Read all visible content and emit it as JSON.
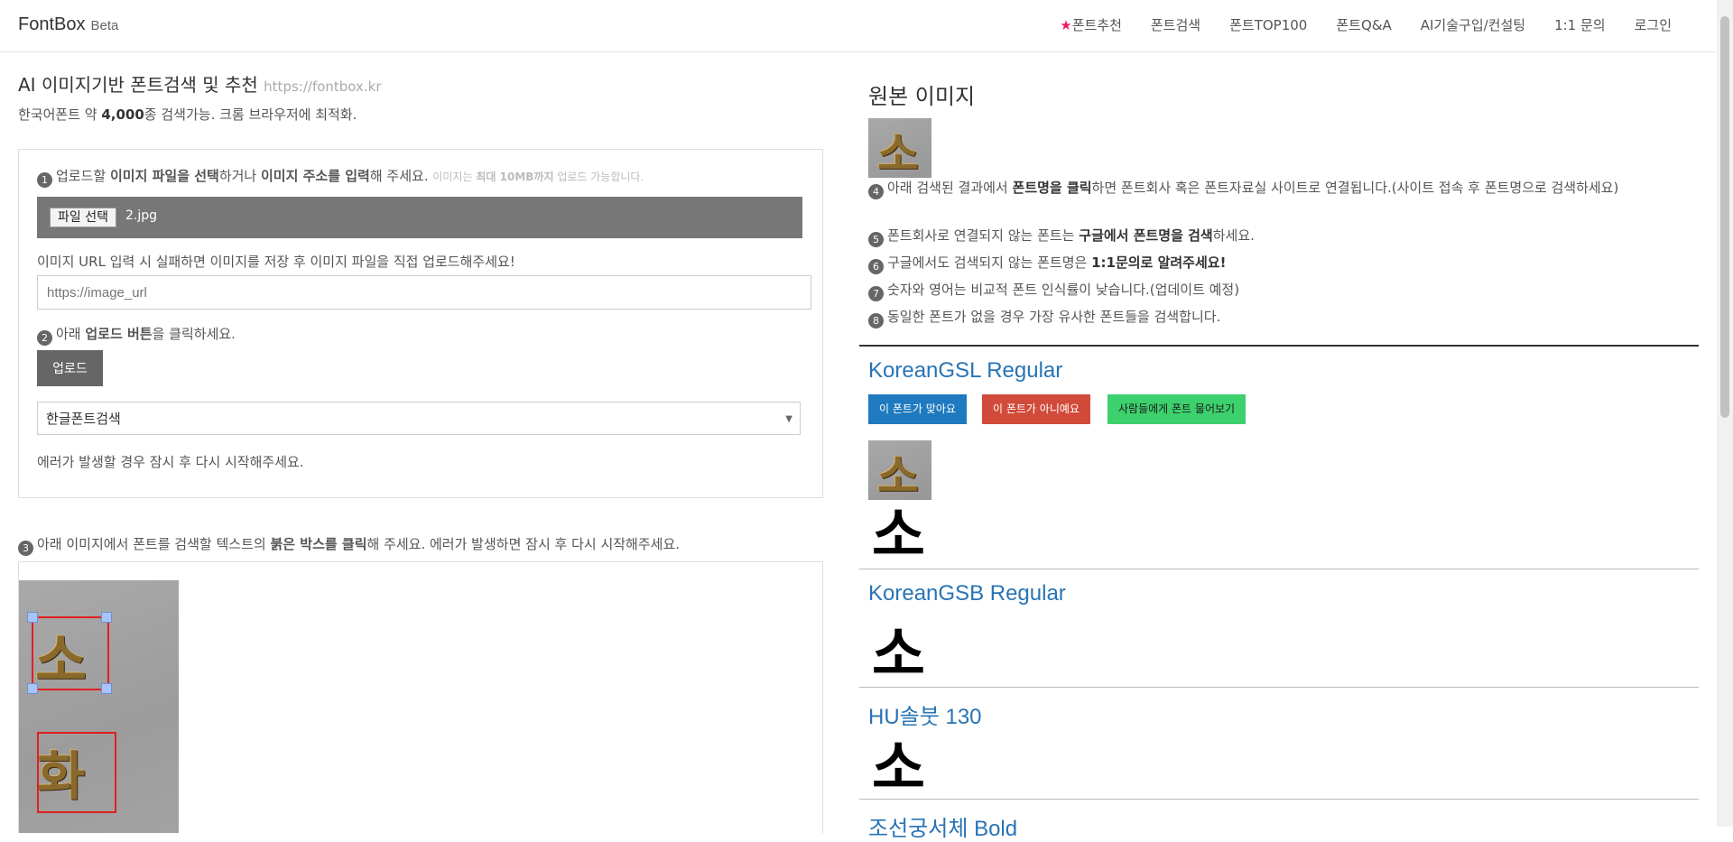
{
  "brand": {
    "name": "FontBox",
    "tag": "Beta"
  },
  "nav": {
    "recommend": "폰트추천",
    "search": "폰트검색",
    "top100": "폰트TOP100",
    "qna": "폰트Q&A",
    "ai": "AI기술구입/컨설팅",
    "inquiry": "1:1 문의",
    "login": "로그인"
  },
  "header": {
    "title": "AI 이미지기반 폰트검색 및 추천",
    "url": "https://fontbox.kr",
    "subtitle_pre": "한국어폰트 약 ",
    "subtitle_count": "4,000",
    "subtitle_post": "종 검색가능. 크롬 브라우저에 최적화."
  },
  "upload": {
    "step1_num": "1",
    "step1_a": "업로드할 ",
    "step1_b": "이미지 파일을 선택",
    "step1_c": "하거나 ",
    "step1_d": "이미지 주소를 입력",
    "step1_e": "해 주세요.",
    "step1_note_a": "이미지는 ",
    "step1_note_b": "최대 10MB까지",
    "step1_note_c": " 업로드 가능합니다.",
    "file_button": "파일 선택",
    "file_name": "2.jpg",
    "url_note": "이미지 URL 입력 시 실패하면 이미지를 저장 후 이미지 파일을 직접 업로드해주세요!",
    "url_placeholder": "https://image_url",
    "step2_num": "2",
    "step2_a": "아래 ",
    "step2_b": "업로드 버튼",
    "step2_c": "을 클릭하세요.",
    "upload_button": "업로드",
    "select_value": "한글폰트검색",
    "error_note": "에러가 발생할 경우 잠시 후 다시 시작해주세요."
  },
  "step3": {
    "num": "3",
    "a": "아래 이미지에서 폰트를 검색할 텍스트의 ",
    "b": "붉은 박스를 클릭",
    "c": "해 주세요. 에러가 발생하면 잠시 후 다시 시작해주세요.",
    "glyph1": "소",
    "glyph2": "화"
  },
  "results": {
    "original_title": "원본 이미지",
    "thumb_glyph": "소",
    "i4_num": "4",
    "i4_a": "아래 검색된 결과에서 ",
    "i4_b": "폰트명을 클릭",
    "i4_c": "하면 폰트회사 혹은 폰트자료실 사이트로 연결됩니다.(사이트 접속 후 폰트명으로 검색하세요)",
    "i5_num": "5",
    "i5_a": "폰트회사로 연결되지 않는 폰트는 ",
    "i5_b": "구글에서 폰트명을 검색",
    "i5_c": "하세요.",
    "i6_num": "6",
    "i6_a": "구글에서도 검색되지 않는 폰트명은 ",
    "i6_b": "1:1문의로 알려주세요!",
    "i7_num": "7",
    "i7_a": "숫자와 영어는 비교적 폰트 인식률이 낮습니다.(업데이트 예정)",
    "i8_num": "8",
    "i8_a": "동일한 폰트가 없을 경우 가장 유사한 폰트들을 검색합니다.",
    "btn_match": "이 폰트가 맞아요",
    "btn_nomatch": "이 폰트가 아니예요",
    "btn_ask": "사람들에게 폰트 물어보기",
    "fonts": [
      {
        "name": "KoreanGSL Regular",
        "sample": "소"
      },
      {
        "name": "KoreanGSB Regular",
        "sample": "소"
      },
      {
        "name": "HU솔붓 130",
        "sample": "소"
      },
      {
        "name": "조선궁서체 Bold"
      }
    ]
  },
  "colors": {
    "accent_blue": "#2874b5",
    "btn_blue": "#1f7ac0",
    "btn_red": "#d24a3a",
    "btn_green": "#3dd16e",
    "star": "#e91e63"
  }
}
